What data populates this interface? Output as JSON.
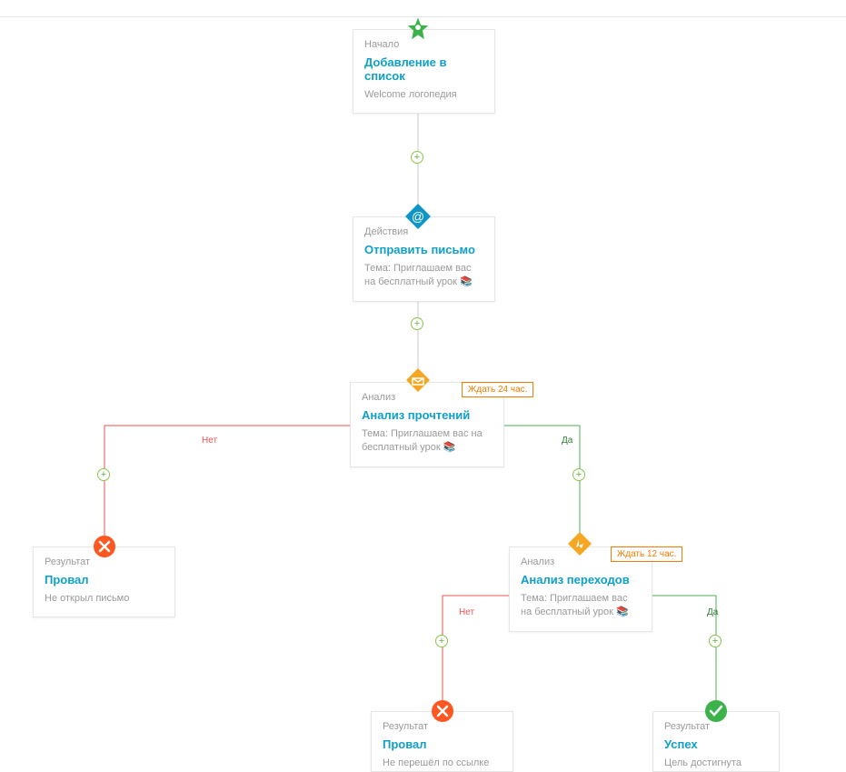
{
  "nodes": {
    "start": {
      "category": "Начало",
      "title": "Добавление в список",
      "sub": "Welcome логопедия"
    },
    "action": {
      "category": "Действия",
      "title": "Отправить письмо",
      "sub": "Тема: Приглашаем вас на бесплатный урок 📚"
    },
    "an1": {
      "category": "Анализ",
      "title": "Анализ прочтений",
      "sub": "Тема: Приглашаем вас на бесплатный урок 📚",
      "wait": "Ждать 24 час."
    },
    "an2": {
      "category": "Анализ",
      "title": "Анализ переходов",
      "sub": "Тема: Приглашаем вас на бесплатный урок 📚",
      "wait": "Ждать 12 час."
    },
    "fail1": {
      "category": "Результат",
      "title": "Провал",
      "sub": "Не открыл письмо"
    },
    "fail2": {
      "category": "Результат",
      "title": "Провал",
      "sub": "Не перешёл по ссылке"
    },
    "succ": {
      "category": "Результат",
      "title": "Успех",
      "sub": "Цель достигнута"
    }
  },
  "labels": {
    "no": "Нет",
    "yes": "Да"
  },
  "colors": {
    "line_gray": "#c9c9c9",
    "line_red": "#ef5350",
    "line_green": "#4caf50",
    "icon_green": "#3bb24a",
    "icon_blue": "#0e95c8",
    "icon_orange_d": "#f5a623",
    "icon_orange_c": "#ff5722"
  },
  "plus_glyph": "+"
}
